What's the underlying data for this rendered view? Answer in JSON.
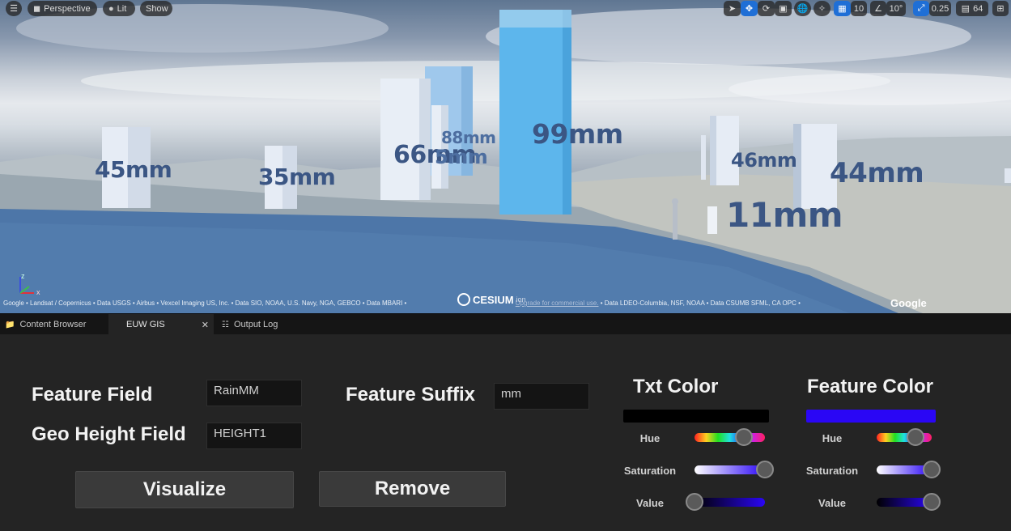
{
  "viewport": {
    "menu_icon": "hamburger-icon",
    "perspective_label": "Perspective",
    "lit_label": "Lit",
    "show_label": "Show",
    "grid_snap_value": "10",
    "rotation_snap_value": "10°",
    "scale_snap_value": "0.25",
    "camera_speed_value": "64",
    "bar_labels": [
      "45mm",
      "35mm",
      "66mm",
      "88mm",
      "5mm",
      "99mm",
      "46mm",
      "44mm",
      "11mm"
    ],
    "attribution_left": "Google • Landsat / Copernicus • Data USGS • Airbus • Vexcel Imaging US, Inc. • Data SIO, NOAA, U.S. Navy, NGA, GEBCO • Data MBARI •",
    "cesium_logo": "CESIUM",
    "cesium_ion": "ion",
    "upgrade_link": "Upgrade for commercial use.",
    "attribution_right": "• Data LDEO-Columbia, NSF, NOAA • Data CSUMB SFML, CA OPC •",
    "google_logo": "Google",
    "axis_z": "z",
    "axis_x": "x"
  },
  "tabs": [
    {
      "label": "Content Browser"
    },
    {
      "label": "EUW GIS"
    },
    {
      "label": "Output Log"
    }
  ],
  "panel": {
    "feature_field_label": "Feature Field",
    "feature_field_value": "RainMM",
    "geo_height_label": "Geo Height Field",
    "geo_height_value": "HEIGHT1",
    "feature_suffix_label": "Feature Suffix",
    "feature_suffix_value": "mm",
    "visualize_button": "Visualize",
    "remove_button": "Remove",
    "txt_color": {
      "title": "Txt Color",
      "swatch": "#000000",
      "hue_label": "Hue",
      "saturation_label": "Saturation",
      "value_label": "Value",
      "hue": 0.7,
      "saturation": 1.0,
      "value": 0.0
    },
    "feature_color": {
      "title": "Feature Color",
      "swatch": "#2a06f5",
      "hue_label": "Hue",
      "saturation_label": "Saturation",
      "value_label": "Value",
      "hue": 0.7,
      "saturation": 1.0,
      "value": 1.0
    }
  }
}
